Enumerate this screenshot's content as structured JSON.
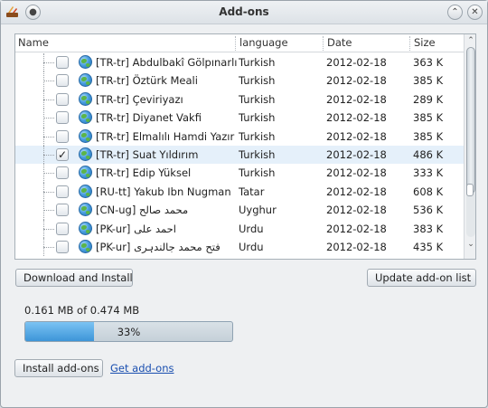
{
  "window": {
    "title": "Add-ons"
  },
  "table": {
    "columns": [
      "Name",
      "language",
      "Date",
      "Size"
    ],
    "rows": [
      {
        "code": "[TR-tr]",
        "name": "Abdulbakî Gölpınarlı",
        "language": "Turkish",
        "date": "2012-02-18",
        "size": "363 K",
        "checked": false
      },
      {
        "code": "[TR-tr]",
        "name": "Öztürk Meali",
        "language": "Turkish",
        "date": "2012-02-18",
        "size": "385 K",
        "checked": false
      },
      {
        "code": "[TR-tr]",
        "name": "Çeviriyazı",
        "language": "Turkish",
        "date": "2012-02-18",
        "size": "289 K",
        "checked": false
      },
      {
        "code": "[TR-tr]",
        "name": "Diyanet Vakfi",
        "language": "Turkish",
        "date": "2012-02-18",
        "size": "385 K",
        "checked": false
      },
      {
        "code": "[TR-tr]",
        "name": "Elmalılı Hamdi Yazır",
        "language": "Turkish",
        "date": "2012-02-18",
        "size": "385 K",
        "checked": false
      },
      {
        "code": "[TR-tr]",
        "name": "Suat Yıldırım",
        "language": "Turkish",
        "date": "2012-02-18",
        "size": "486 K",
        "checked": true
      },
      {
        "code": "[TR-tr]",
        "name": "Edip Yüksel",
        "language": "Turkish",
        "date": "2012-02-18",
        "size": "333 K",
        "checked": false
      },
      {
        "code": "[RU-tt]",
        "name": "Yakub Ibn Nugman",
        "language": "Tatar",
        "date": "2012-02-18",
        "size": "608 K",
        "checked": false
      },
      {
        "code": "[CN-ug]",
        "name": "محمد صالح",
        "language": "Uyghur",
        "date": "2012-02-18",
        "size": "536 K",
        "checked": false
      },
      {
        "code": "[PK-ur]",
        "name": "احمد علی",
        "language": "Urdu",
        "date": "2012-02-18",
        "size": "383 K",
        "checked": false
      },
      {
        "code": "[PK-ur]",
        "name": "فتح محمد جالندہری",
        "language": "Urdu",
        "date": "2012-02-18",
        "size": "435 K",
        "checked": false
      }
    ],
    "checkmark": "✓"
  },
  "buttons": {
    "download_install": "Download and Install",
    "update_list": "Update add-on list",
    "install_addons": "Install add-ons"
  },
  "progress": {
    "status": "0.161 MB of 0.474 MB",
    "percent": 33,
    "label": "33%"
  },
  "links": {
    "get_addons": "Get add-ons"
  },
  "colors": {
    "selected_row": "#e5f0fa",
    "progress_fill": "#4fa6e6",
    "link": "#1a4fb0"
  }
}
